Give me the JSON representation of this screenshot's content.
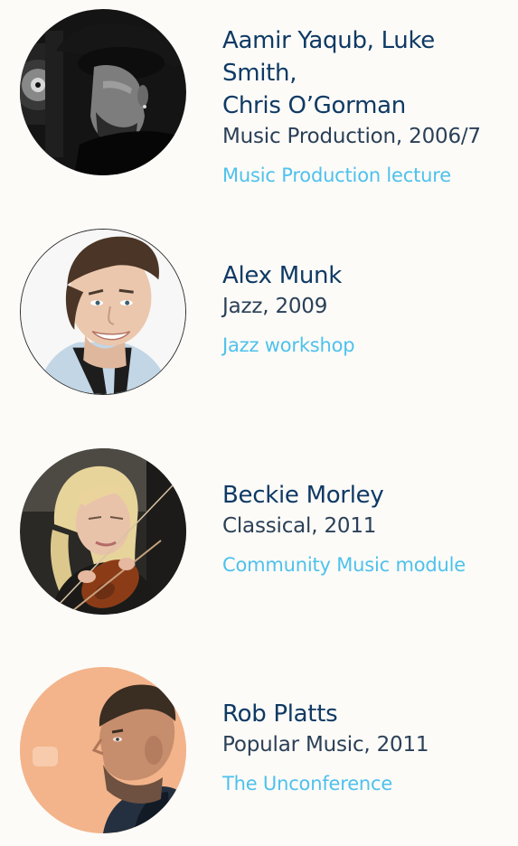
{
  "people": [
    {
      "name_line1": "Aamir Yaqub, Luke Smith,",
      "name_line2": "Chris O’Gorman",
      "meta": "Music Production, 2006/7",
      "link": "Music Production lecture"
    },
    {
      "name_line1": "Alex Munk",
      "meta": "Jazz, 2009",
      "link": "Jazz workshop"
    },
    {
      "name_line1": "Beckie Morley",
      "meta": "Classical, 2011",
      "link": "Community Music module"
    },
    {
      "name_line1": "Rob Platts",
      "meta": "Popular Music, 2011",
      "link": "The Unconference"
    }
  ],
  "colors": {
    "background": "#fcfbf8",
    "name": "#0f3a64",
    "meta": "#2b4057",
    "link": "#4ec1ec"
  },
  "images": {
    "avatar_1": "person-photo-music-production",
    "avatar_2": "person-photo-jazz",
    "avatar_3": "person-photo-classical-violin",
    "avatar_4": "person-photo-popular-music"
  }
}
